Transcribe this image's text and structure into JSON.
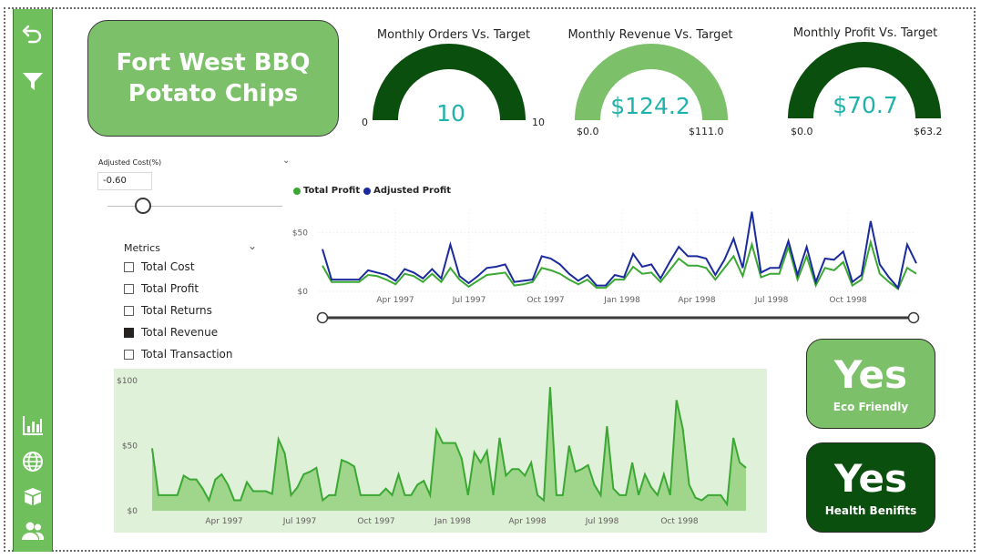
{
  "sidebar": {
    "top_icons": [
      {
        "name": "back-arrow-icon",
        "glyph": "undo"
      },
      {
        "name": "filter-icon",
        "glyph": "funnel"
      }
    ],
    "bottom_icons": [
      {
        "name": "bar-chart-icon"
      },
      {
        "name": "globe-icon"
      },
      {
        "name": "box-icon"
      },
      {
        "name": "users-icon"
      }
    ],
    "color": "#6fbf5c"
  },
  "title_card": {
    "text": "Fort West BBQ\nPotato Chips",
    "color": "#7cc06a"
  },
  "gauges": [
    {
      "title": "Monthly Orders Vs. Target",
      "value_label": "10",
      "min_label": "0",
      "max_label": "10",
      "value": 10,
      "max": 10,
      "fill_color": "#0b4f0f"
    },
    {
      "title": "Monthly Revenue Vs. Target",
      "value_label": "$124.2",
      "min_label": "$0.0",
      "max_label": "$111.0",
      "value": 124.2,
      "max": 111.0,
      "fill_color": "#7cc06a"
    },
    {
      "title": "Monthly Profit Vs. Target",
      "value_label": "$70.7",
      "min_label": "$0.0",
      "max_label": "$63.2",
      "value": 70.7,
      "max": 63.2,
      "fill_color": "#0b4f0f"
    }
  ],
  "adjusted_cost": {
    "label": "Adjusted Cost(%)",
    "value": "-0.60"
  },
  "metrics": {
    "title": "Metrics",
    "items": [
      {
        "label": "Total Cost",
        "checked": false
      },
      {
        "label": "Total Profit",
        "checked": false
      },
      {
        "label": "Total Returns",
        "checked": false
      },
      {
        "label": "Total Revenue",
        "checked": true
      },
      {
        "label": "Total Transaction",
        "checked": false
      }
    ]
  },
  "kpi_cards": [
    {
      "value": "Yes",
      "label": "Eco Friendly",
      "color": "#7cc06a"
    },
    {
      "value": "Yes",
      "label": "Health Benifits",
      "color": "#0b4f0f"
    }
  ],
  "chart_data": [
    {
      "type": "line",
      "legend": "top-left",
      "grid": true,
      "x_tick_labels": [
        "Apr 1997",
        "Jul 1997",
        "Oct 1997",
        "Jan 1998",
        "Apr 1998",
        "Jul 1998",
        "Oct 1998"
      ],
      "y_tick_labels": [
        "$0",
        "$50"
      ],
      "ylim": [
        0,
        70
      ],
      "series": [
        {
          "name": "Total Profit",
          "color": "#3aa832",
          "values": [
            22,
            8,
            8,
            8,
            8,
            14,
            13,
            10,
            6,
            15,
            13,
            8,
            15,
            8,
            20,
            10,
            4,
            9,
            14,
            15,
            16,
            5,
            6,
            8,
            20,
            18,
            15,
            10,
            6,
            10,
            3,
            3,
            10,
            10,
            21,
            15,
            16,
            8,
            18,
            28,
            22,
            22,
            20,
            10,
            20,
            30,
            13,
            40,
            12,
            15,
            15,
            38,
            10,
            30,
            5,
            20,
            18,
            25,
            5,
            10,
            42,
            15,
            8,
            2,
            20,
            15
          ]
        },
        {
          "name": "Adjusted Profit",
          "color": "#1b2a9c",
          "values": [
            36,
            10,
            10,
            10,
            10,
            18,
            16,
            14,
            9,
            19,
            16,
            11,
            19,
            11,
            40,
            13,
            7,
            13,
            20,
            21,
            23,
            8,
            9,
            10,
            30,
            28,
            23,
            15,
            9,
            14,
            5,
            5,
            14,
            12,
            32,
            21,
            23,
            11,
            25,
            38,
            30,
            30,
            28,
            14,
            27,
            45,
            20,
            68,
            16,
            20,
            20,
            43,
            14,
            38,
            8,
            28,
            27,
            34,
            8,
            14,
            60,
            23,
            12,
            3,
            40,
            24
          ]
        }
      ]
    },
    {
      "type": "area",
      "grid": false,
      "x_tick_labels": [
        "Apr 1997",
        "Jul 1997",
        "Oct 1997",
        "Jan 1998",
        "Apr 1998",
        "Jul 1998",
        "Oct 1998"
      ],
      "y_tick_labels": [
        "$0",
        "$50",
        "$100"
      ],
      "ylim": [
        0,
        100
      ],
      "series": [
        {
          "name": "Total Revenue",
          "color": "#3aa832",
          "fill": "#a0d68c",
          "values": [
            48,
            12,
            12,
            12,
            12,
            27,
            24,
            24,
            17,
            8,
            24,
            28,
            20,
            8,
            8,
            22,
            15,
            15,
            15,
            13,
            55,
            44,
            12,
            18,
            28,
            30,
            33,
            8,
            12,
            12,
            39,
            37,
            34,
            12,
            12,
            12,
            12,
            17,
            12,
            28,
            12,
            12,
            20,
            23,
            12,
            62,
            52,
            52,
            52,
            40,
            12,
            45,
            37,
            46,
            12,
            56,
            27,
            32,
            32,
            27,
            37,
            12,
            8,
            95,
            12,
            12,
            50,
            30,
            32,
            35,
            20,
            12,
            65,
            17,
            12,
            12,
            37,
            12,
            28,
            18,
            12,
            28,
            12,
            85,
            63,
            20,
            10,
            8,
            12,
            12,
            12,
            5,
            56,
            37,
            33
          ]
        }
      ]
    }
  ]
}
